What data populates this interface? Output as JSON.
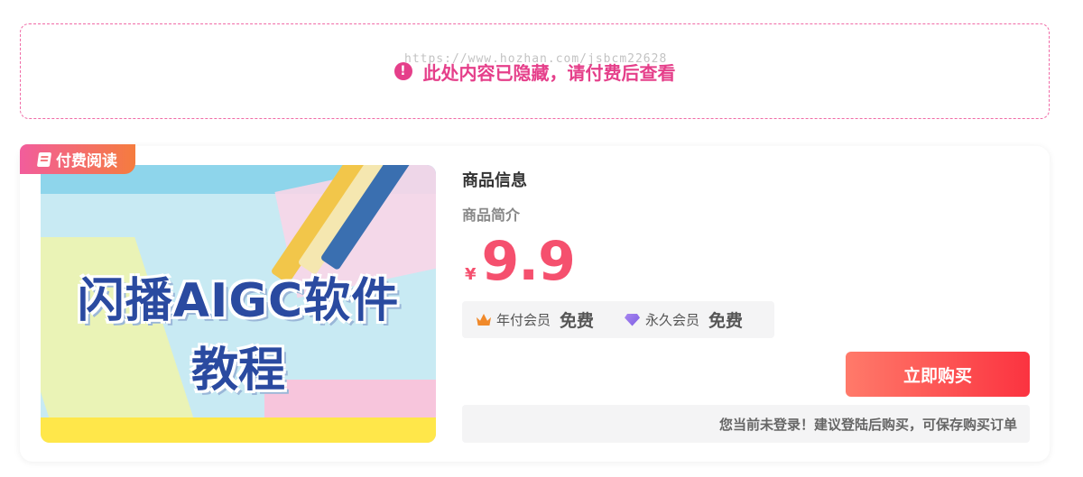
{
  "hidden_notice": {
    "icon": "exclamation-circle-icon",
    "text": "此处内容已隐藏，请付费后查看",
    "watermark": "https://www.hozhan.com/jsbcm22628",
    "color": "#e53f8a"
  },
  "product": {
    "badge": "付费阅读",
    "badge_icon": "book-icon",
    "thumbnail": {
      "line1": "闪播AIGC软件",
      "line2": "教程"
    },
    "title": "商品信息",
    "subtitle": "商品简介",
    "currency": "¥",
    "price": "9.9",
    "price_color": "#f5506e",
    "members": [
      {
        "icon": "crown-icon",
        "label": "年付会员",
        "value": "免费"
      },
      {
        "icon": "diamond-icon",
        "label": "永久会员",
        "value": "免费"
      }
    ],
    "buy_label": "立即购买",
    "login_tip": "您当前未登录！建议登陆后购买，可保存购买订单"
  }
}
